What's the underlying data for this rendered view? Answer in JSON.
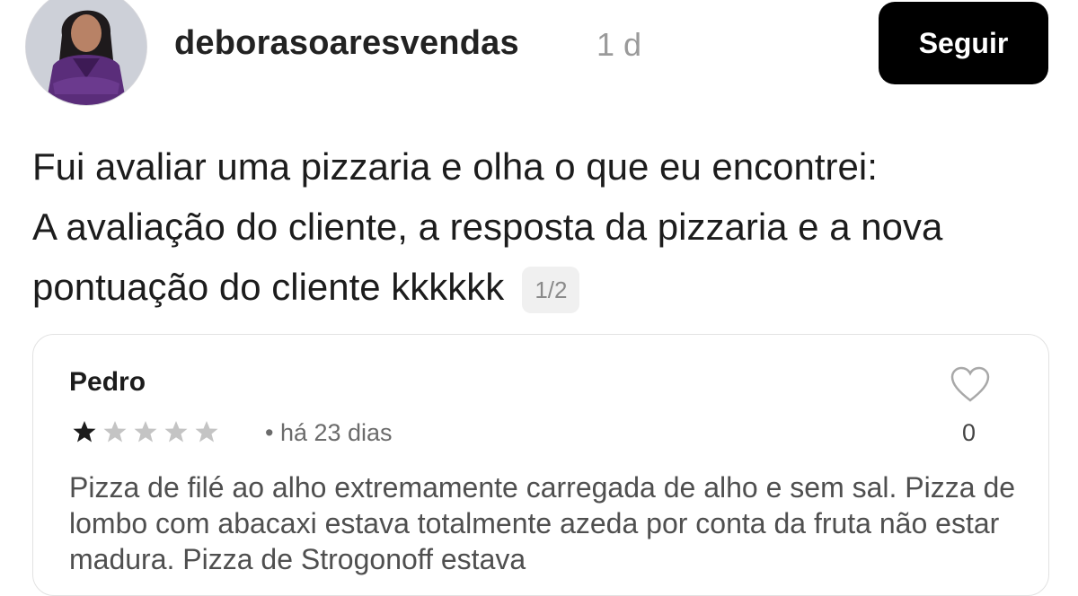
{
  "post": {
    "username": "deborasoaresvendas",
    "time": "1 d",
    "follow_label": "Seguir",
    "caption_lines": [
      "Fui avaliar uma pizzaria e olha o que eu encontrei:",
      "A avaliação do cliente, a resposta da pizzaria e a nova",
      "pontuação do cliente kkkkkk"
    ],
    "pager": "1/2"
  },
  "review": {
    "name": "Pedro",
    "rating": 1,
    "max_rating": 5,
    "date": "• há 23 dias",
    "likes": "0",
    "text": "Pizza de filé ao alho extremamente carregada de alho e sem sal. Pizza de lombo com abacaxi estava totalmente azeda por conta da fruta não estar madura. Pizza de Strogonoff estava"
  },
  "colors": {
    "follow_bg": "#000000",
    "star_filled": "#1c1c1c",
    "star_empty": "#c4c4c4"
  }
}
